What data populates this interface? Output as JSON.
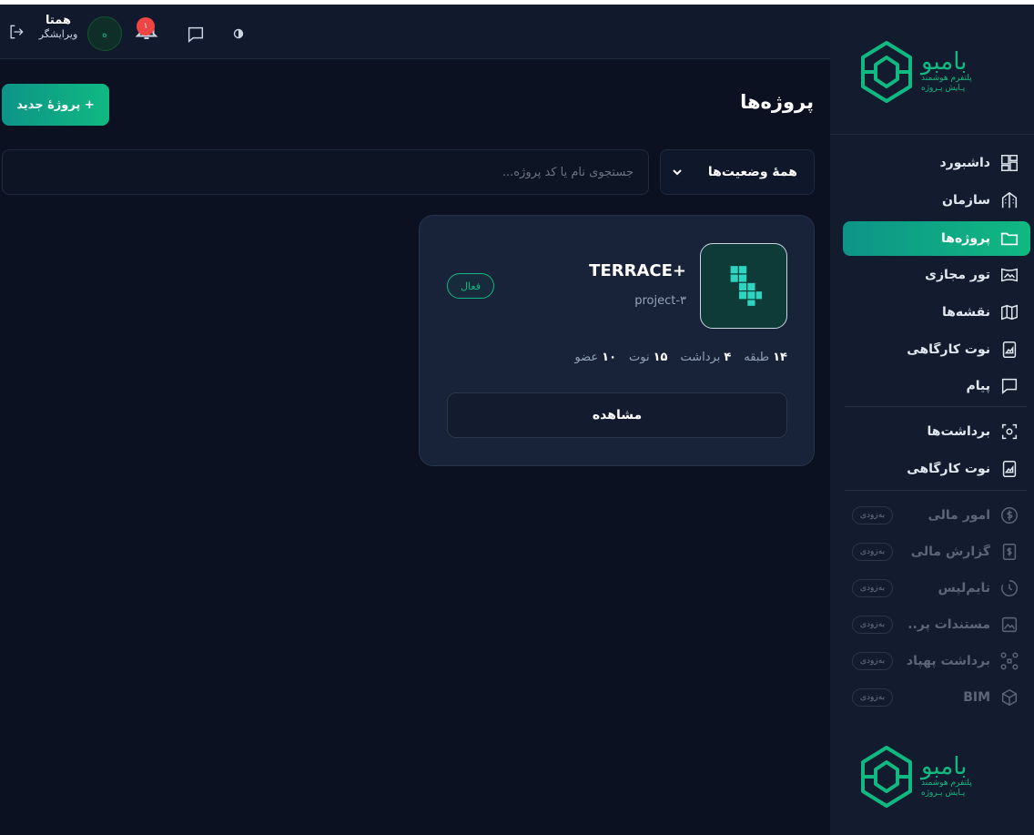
{
  "brand": {
    "name": "بامبو",
    "tagline_line1": "پلتفرم هوشمند",
    "tagline_line2": "پـایش پـروژه",
    "color": "#10b981"
  },
  "header": {
    "user_name": "همتا",
    "user_role": "ویرایشگر",
    "avatar_text": "ه",
    "notification_count": "۱",
    "icons": [
      "logout-icon",
      "bell-icon",
      "chat-icon",
      "theme-icon"
    ]
  },
  "sidebar": {
    "items": [
      {
        "label": "داشبورد",
        "icon": "dashboard-icon"
      },
      {
        "label": "سازمان",
        "icon": "building-icon"
      },
      {
        "label": "پروژه‌ها",
        "icon": "folder-icon",
        "active": true
      },
      {
        "label": "تور مجازی",
        "icon": "panorama-icon"
      },
      {
        "label": "نقشه‌ها",
        "icon": "map-icon"
      },
      {
        "label": "نوت کارگاهی",
        "icon": "notebook-icon"
      },
      {
        "label": "پیام",
        "icon": "message-icon"
      }
    ],
    "items2": [
      {
        "label": "برداشت‌ها",
        "icon": "scan-icon"
      },
      {
        "label": "نوت کارگاهی",
        "icon": "notebook-icon"
      }
    ],
    "disabled_items": [
      {
        "label": "امور مالی",
        "icon": "dollar-icon",
        "badge": "به‌زودی"
      },
      {
        "label": "گزارش مالی",
        "icon": "report-icon",
        "badge": "به‌زودی"
      },
      {
        "label": "تایم‌لپس",
        "icon": "clock-icon",
        "badge": "به‌زودی"
      },
      {
        "label": "مستندات پر...",
        "icon": "image-icon",
        "badge": "به‌زودی"
      },
      {
        "label": "برداشت پهپاد",
        "icon": "drone-icon",
        "badge": "به‌زودی"
      },
      {
        "label": "BIM",
        "icon": "cube-icon",
        "badge": "به‌زودی"
      }
    ]
  },
  "main": {
    "title": "پروژه‌ها",
    "new_button": "+ پروژهٔ جدید",
    "status_filter": "همهٔ وضعیت‌ها",
    "search_placeholder": "جستجوی نام یا کد پروژه..."
  },
  "project": {
    "name": "TERRACE+",
    "code": "project-۳",
    "status": "فعال",
    "stats": [
      {
        "value": "۱۴",
        "label": "طبقه"
      },
      {
        "value": "۴",
        "label": "برداشت"
      },
      {
        "value": "۱۵",
        "label": "نوت"
      },
      {
        "value": "۱۰",
        "label": "عضو"
      }
    ],
    "view_button": "مشاهده"
  }
}
